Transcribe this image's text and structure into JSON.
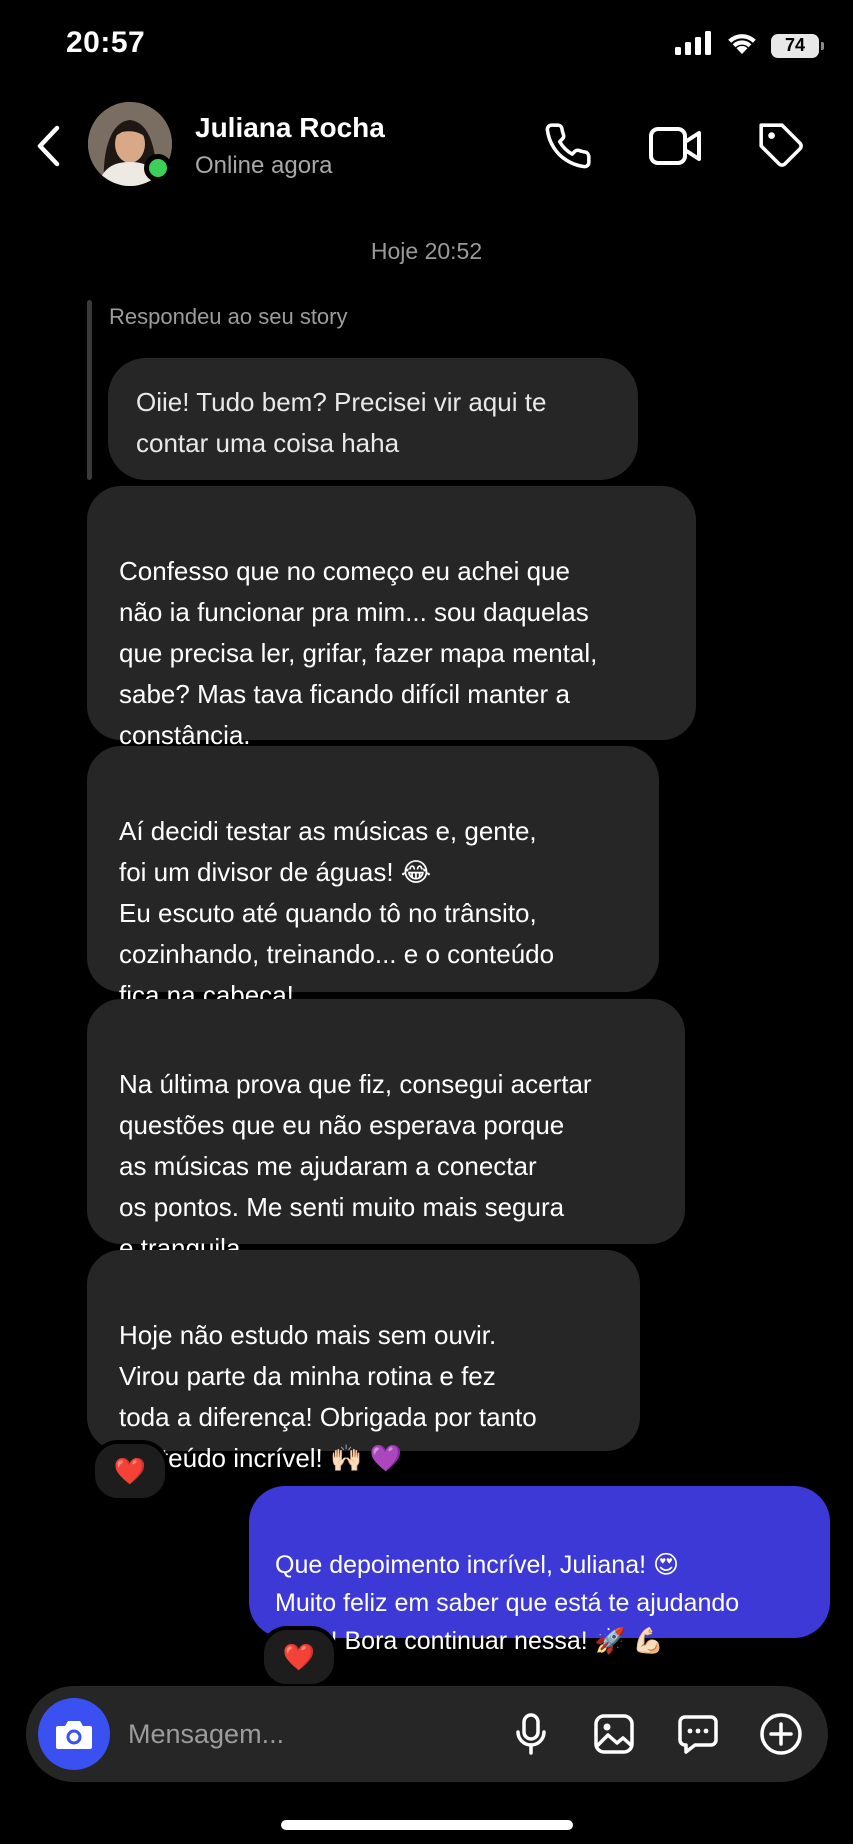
{
  "status_bar": {
    "time": "20:57",
    "battery": "74"
  },
  "header": {
    "contact_name": "Juliana Rocha",
    "contact_status": "Online agora"
  },
  "conversation": {
    "day_stamp": "Hoje 20:52",
    "story_reply": {
      "label": "Respondeu ao seu story",
      "text": "Oiie! Tudo bem? Precisei vir aqui te\ncontar uma coisa haha"
    },
    "incoming_messages": [
      {
        "text": "Confesso que no começo eu achei que\nnão ia funcionar pra mim... sou daquelas\nque precisa ler, grifar, fazer mapa mental,\nsabe? Mas tava ficando difícil manter a\nconstância."
      },
      {
        "text": "Aí decidi testar as músicas e, gente,\nfoi um divisor de águas! 😂\nEu escuto até quando tô no trânsito,\ncozinhando, treinando... e o conteúdo\nfica na cabeça!"
      },
      {
        "text": "Na última prova que fiz, consegui acertar\nquestões que eu não esperava porque\nas músicas me ajudaram a conectar\nos pontos. Me senti muito mais segura\ne tranquila."
      },
      {
        "text": "Hoje não estudo mais sem ouvir.\nVirou parte da minha rotina e fez\ntoda a diferença! Obrigada por tanto\nconteúdo incrível! 🙌🏻 💜"
      }
    ],
    "reaction_incoming": "❤️",
    "outgoing_message": {
      "text": "Que depoimento incrível, Juliana! 😍\nMuito feliz em saber que está te ajudando\ntanto! Bora continuar nessa! 🚀 💪🏻"
    },
    "reaction_outgoing": "❤️"
  },
  "composer": {
    "placeholder": "Mensagem..."
  },
  "colors": {
    "background": "#000000",
    "incoming_bubble": "#262626",
    "outgoing_bubble": "#3c39d6",
    "camera_button": "#3b50f0",
    "online_dot": "#3ad05a"
  }
}
